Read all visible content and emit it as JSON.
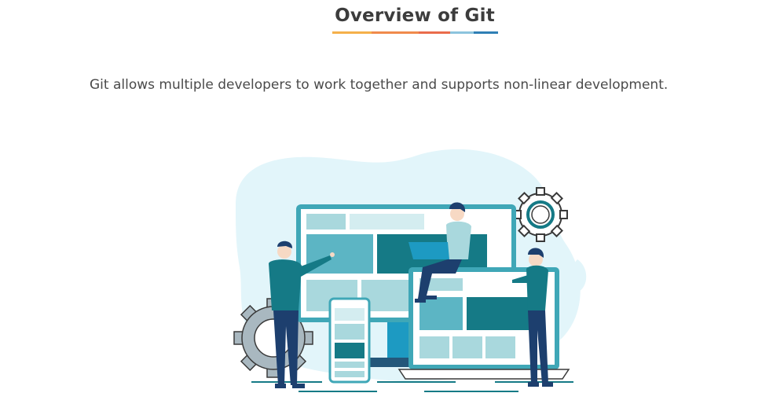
{
  "slide": {
    "title": "Overview of Git",
    "body_text": "Git allows multiple developers to work together and supports non-linear development."
  },
  "colors": {
    "underline": [
      "#f5b04a",
      "#f08a4b",
      "#ea6c4c",
      "#5aa0c8",
      "#2f7fb5"
    ],
    "teal_dark": "#157a86",
    "teal_mid": "#3fa7b7",
    "teal_light": "#a9d8dd",
    "navy": "#1d3f6e",
    "blob": "#e2f5fa"
  },
  "illustration": {
    "description_icons": [
      "monitor-icon",
      "laptop-icon",
      "phone-icon",
      "gear-icon",
      "developer-figure-icon"
    ]
  }
}
